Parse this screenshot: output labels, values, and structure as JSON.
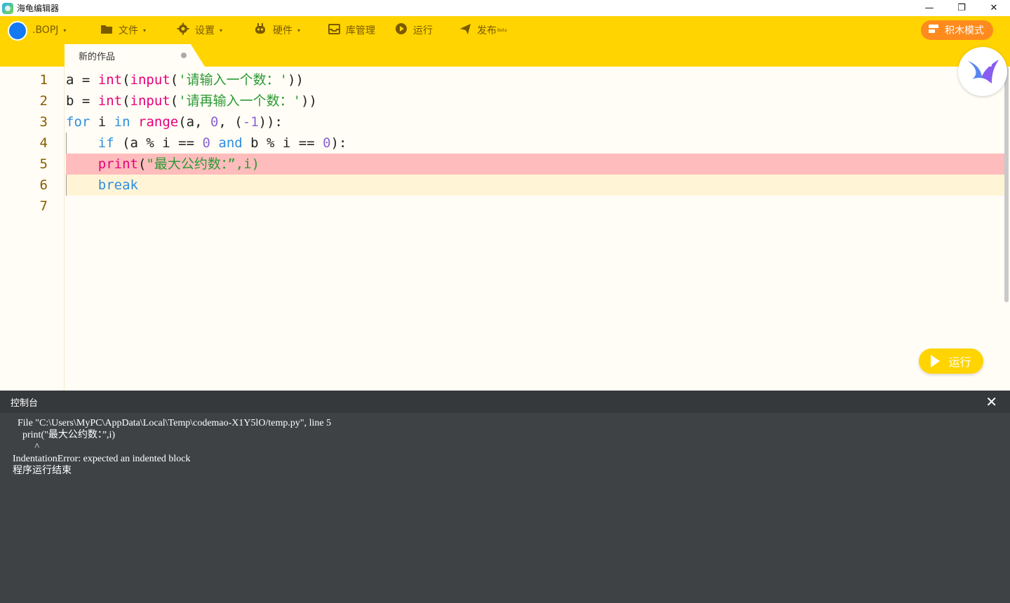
{
  "window": {
    "title": "海龟编辑器",
    "minimize": "—",
    "restore": "❐",
    "close": "✕"
  },
  "toolbar": {
    "project": ".BOPJ",
    "file": "文件",
    "settings": "设置",
    "hardware": "硬件",
    "library": "库管理",
    "run": "运行",
    "publish": "发布",
    "publish_badge": "Beta",
    "block_mode": "积木模式",
    "caret": "▾"
  },
  "tabs": [
    {
      "label": "新的作品"
    }
  ],
  "editor": {
    "line_numbers": [
      "1",
      "2",
      "3",
      "4",
      "5",
      "6",
      "7"
    ],
    "lines": [
      {
        "t1": "a = ",
        "fn1": "int",
        "p1": "(",
        "fn2": "input",
        "p2": "(",
        "str": "'请输入一个数：'",
        "end": "))"
      },
      {
        "t1": "b = ",
        "fn1": "int",
        "p1": "(",
        "fn2": "input",
        "p2": "(",
        "str": "'请再输入一个数：'",
        "end": "))"
      },
      {
        "kw1": "for",
        "t1": " i ",
        "kw2": "in",
        "sp": " ",
        "fn1": "range",
        "t2": "(a, ",
        "n1": "0",
        "t3": ", (",
        "n2": "-1",
        "t4": ")):"
      },
      {
        "indent": "    ",
        "kw1": "if",
        "t1": " (a % i == ",
        "n1": "0",
        "sp": " ",
        "kw2": "and",
        "t2": " b % i == ",
        "n2": "0",
        "t3": "):"
      },
      {
        "indent": "    ",
        "fn1": "print",
        "p1": "(",
        "str": "\"最大公约数：”,i)"
      },
      {
        "indent": "    ",
        "kw1": "break"
      },
      {}
    ],
    "error_line": 5,
    "active_line": 6
  },
  "run_button": "运行",
  "console": {
    "title": "控制台",
    "close": "✕",
    "output": [
      "  File \"C:\\Users\\MyPC\\AppData\\Local\\Temp\\codemao-X1Y5lO/temp.py\", line 5",
      "    print(\"最大公约数：”,i)",
      "         ^",
      "IndentationError: expected an indented block",
      "程序运行结束"
    ]
  },
  "colors": {
    "toolbar_bg": "#ffd400",
    "error_line_bg": "#ffbcbc",
    "console_bg": "#3f4245",
    "accent_orange": "#ff8a1d"
  },
  "icons": [
    "folder-icon",
    "gear-icon",
    "hardware-icon",
    "inbox-icon",
    "play-icon",
    "send-icon",
    "blocks-icon",
    "close-icon",
    "mascot-bird-icon"
  ]
}
